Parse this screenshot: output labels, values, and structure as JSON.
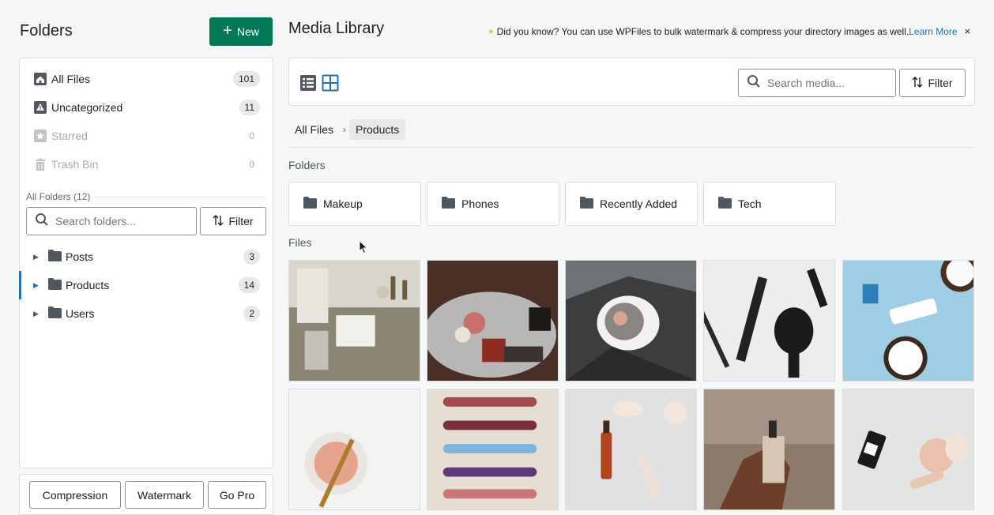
{
  "sidebar": {
    "title": "Folders",
    "new_button": "New",
    "nav": [
      {
        "label": "All Files",
        "count": "101",
        "icon": "home-icon"
      },
      {
        "label": "Uncategorized",
        "count": "11",
        "icon": "warning-icon"
      },
      {
        "label": "Starred",
        "count": "0",
        "icon": "star-icon"
      },
      {
        "label": "Trash Bin",
        "count": "0",
        "icon": "trash-icon"
      }
    ],
    "all_folders_label": "All Folders (12)",
    "search_placeholder": "Search folders...",
    "filter_label": "Filter",
    "tree": [
      {
        "label": "Posts",
        "count": "3"
      },
      {
        "label": "Products",
        "count": "14",
        "active": true
      },
      {
        "label": "Users",
        "count": "2"
      }
    ],
    "bottom_buttons": [
      "Compression",
      "Watermark",
      "Go Pro"
    ]
  },
  "main": {
    "title": "Media Library",
    "tip": {
      "text": "Did you know?  You can use WPFiles to bulk watermark & compress your directory images as well.",
      "link": "Learn More",
      "close": "×"
    },
    "search_placeholder": "Search media...",
    "filter_label": "Filter",
    "breadcrumb": [
      "All Files",
      "Products"
    ],
    "folders_label": "Folders",
    "folders": [
      "Makeup",
      "Phones",
      "Recently Added",
      "Tech"
    ],
    "files_label": "Files",
    "files": [
      {
        "subject": "lab-workspace-photo"
      },
      {
        "subject": "cosmetics-flowers-photo"
      },
      {
        "subject": "car-mirror-photo"
      },
      {
        "subject": "hair-tools-photo"
      },
      {
        "subject": "coconut-cream-photo"
      },
      {
        "subject": "powder-brush-photo"
      },
      {
        "subject": "face-rollers-photo"
      },
      {
        "subject": "serum-roller-photo"
      },
      {
        "subject": "perfume-hand-photo"
      },
      {
        "subject": "dark-bottle-crystal-photo"
      }
    ]
  },
  "colors": {
    "accent": "#007a55",
    "link": "#2271b1",
    "active_indicator": "#2271b1"
  }
}
